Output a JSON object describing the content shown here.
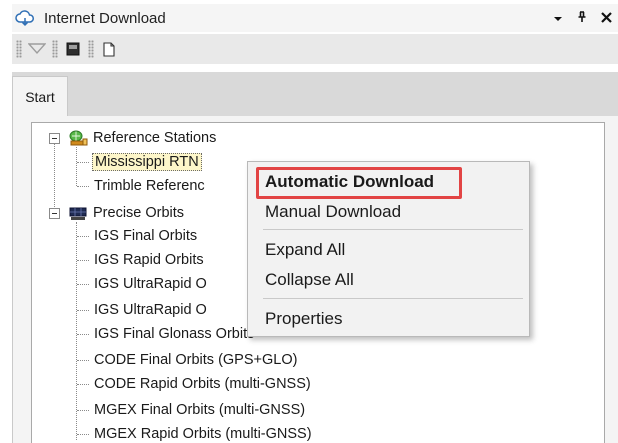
{
  "window": {
    "title": "Internet Download",
    "controls": {
      "dropdown": "▾",
      "pin": "ᵩ",
      "close": "✕"
    }
  },
  "tabs": [
    {
      "label": "Start",
      "active": true
    }
  ],
  "tree": {
    "groups": [
      {
        "label": "Reference Stations",
        "icon": "network-station-icon",
        "expanded": true,
        "children": [
          {
            "label": "Mississippi RTN",
            "selected": true
          },
          {
            "label": "Trimble Referenc"
          }
        ]
      },
      {
        "label": "Precise Orbits",
        "icon": "satellite-orbit-icon",
        "expanded": true,
        "children": [
          {
            "label": "IGS Final Orbits"
          },
          {
            "label": "IGS Rapid Orbits"
          },
          {
            "label": "IGS UltraRapid O"
          },
          {
            "label": "IGS UltraRapid O"
          },
          {
            "label": "IGS Final Glonass Orbits"
          },
          {
            "label": "CODE Final Orbits (GPS+GLO)"
          },
          {
            "label": "CODE Rapid Orbits (multi-GNSS)"
          },
          {
            "label": "MGEX Final Orbits (multi-GNSS)"
          },
          {
            "label": "MGEX Rapid Orbits (multi-GNSS)"
          }
        ]
      }
    ]
  },
  "context_menu": {
    "items": [
      {
        "label": "Automatic Download",
        "bold": true,
        "highlighted": true
      },
      {
        "label": "Manual Download"
      },
      {
        "label": "Expand All"
      },
      {
        "label": "Collapse All"
      },
      {
        "label": "Properties"
      }
    ],
    "highlight_color": "#e24444"
  },
  "colors": {
    "selection_fill": "#fdf6c9",
    "menu_background": "#f2f2f2",
    "tab_strip": "#d9d9d9"
  }
}
